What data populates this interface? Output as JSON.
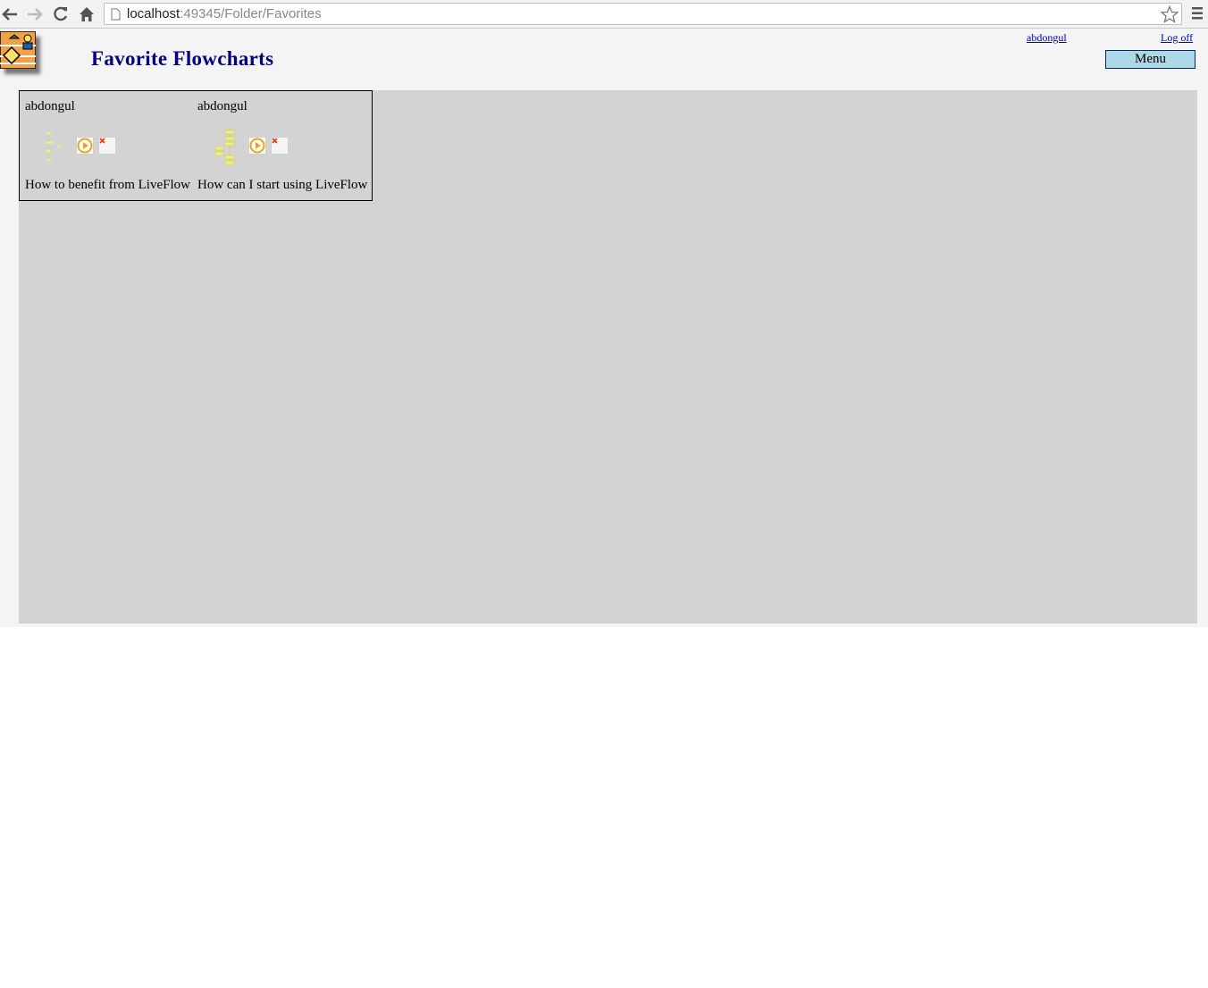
{
  "browser": {
    "url_host": "localhost",
    "url_rest": ":49345/Folder/Favorites"
  },
  "header": {
    "title": "Favorite Flowcharts",
    "user_link": "abdongul",
    "logoff_link": "Log off",
    "menu_label": "Menu"
  },
  "favorites": [
    {
      "author": "abdongul",
      "title": "How to benefit from LiveFlow"
    },
    {
      "author": "abdongul",
      "title": "How can I start using LiveFlow"
    }
  ],
  "colors": {
    "title": "#000080",
    "menu_bg": "#add8e6",
    "content_bg": "#d3d3d3",
    "link": "#0000cc"
  }
}
